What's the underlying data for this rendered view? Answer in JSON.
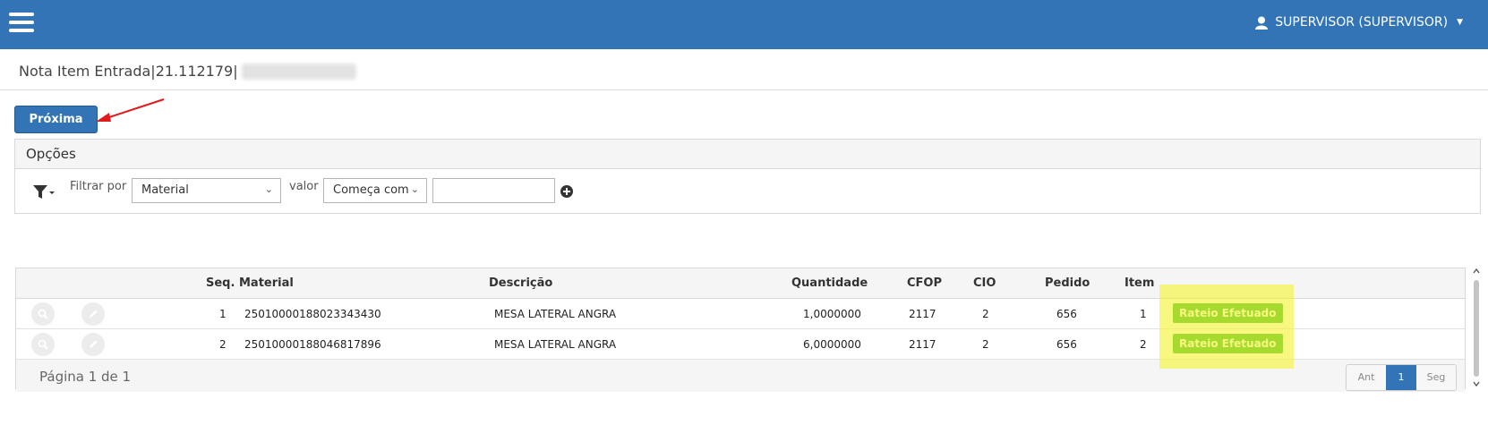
{
  "header": {
    "user": "SUPERVISOR (SUPERVISOR)"
  },
  "page": {
    "title": "Nota Item Entrada|21.112179|"
  },
  "toolbar": {
    "next_label": "Próxima"
  },
  "options": {
    "title": "Opções",
    "filter_by_label": "Filtrar por",
    "filter_field": "Material",
    "value_label": "valor",
    "operator": "Começa com",
    "value_input": ""
  },
  "table": {
    "columns": {
      "seq": "Seq.",
      "material": "Material",
      "descricao": "Descrição",
      "quantidade": "Quantidade",
      "cfop": "CFOP",
      "cio": "CIO",
      "pedido": "Pedido",
      "item": "Item"
    },
    "rows": [
      {
        "seq": "1",
        "material": "25010000188023343430",
        "descricao": "MESA LATERAL ANGRA",
        "quantidade": "1,0000000",
        "cfop": "2117",
        "cio": "2",
        "pedido": "656",
        "item": "1",
        "status": "Rateio Efetuado"
      },
      {
        "seq": "2",
        "material": "25010000188046817896",
        "descricao": "MESA LATERAL ANGRA",
        "quantidade": "6,0000000",
        "cfop": "2117",
        "cio": "2",
        "pedido": "656",
        "item": "2",
        "status": "Rateio Efetuado"
      }
    ],
    "footer": {
      "page_info": "Página 1 de 1",
      "prev": "Ant",
      "current": "1",
      "next": "Seg"
    }
  },
  "colors": {
    "header_bg": "#3274b6",
    "badge_green": "#16a816",
    "highlight": "#f5f53c",
    "arrow": "#e01b1b"
  },
  "icons": [
    "menu-icon",
    "user-icon",
    "filter-icon",
    "add-circle-icon",
    "search-icon",
    "edit-icon",
    "arrow-annotation"
  ]
}
